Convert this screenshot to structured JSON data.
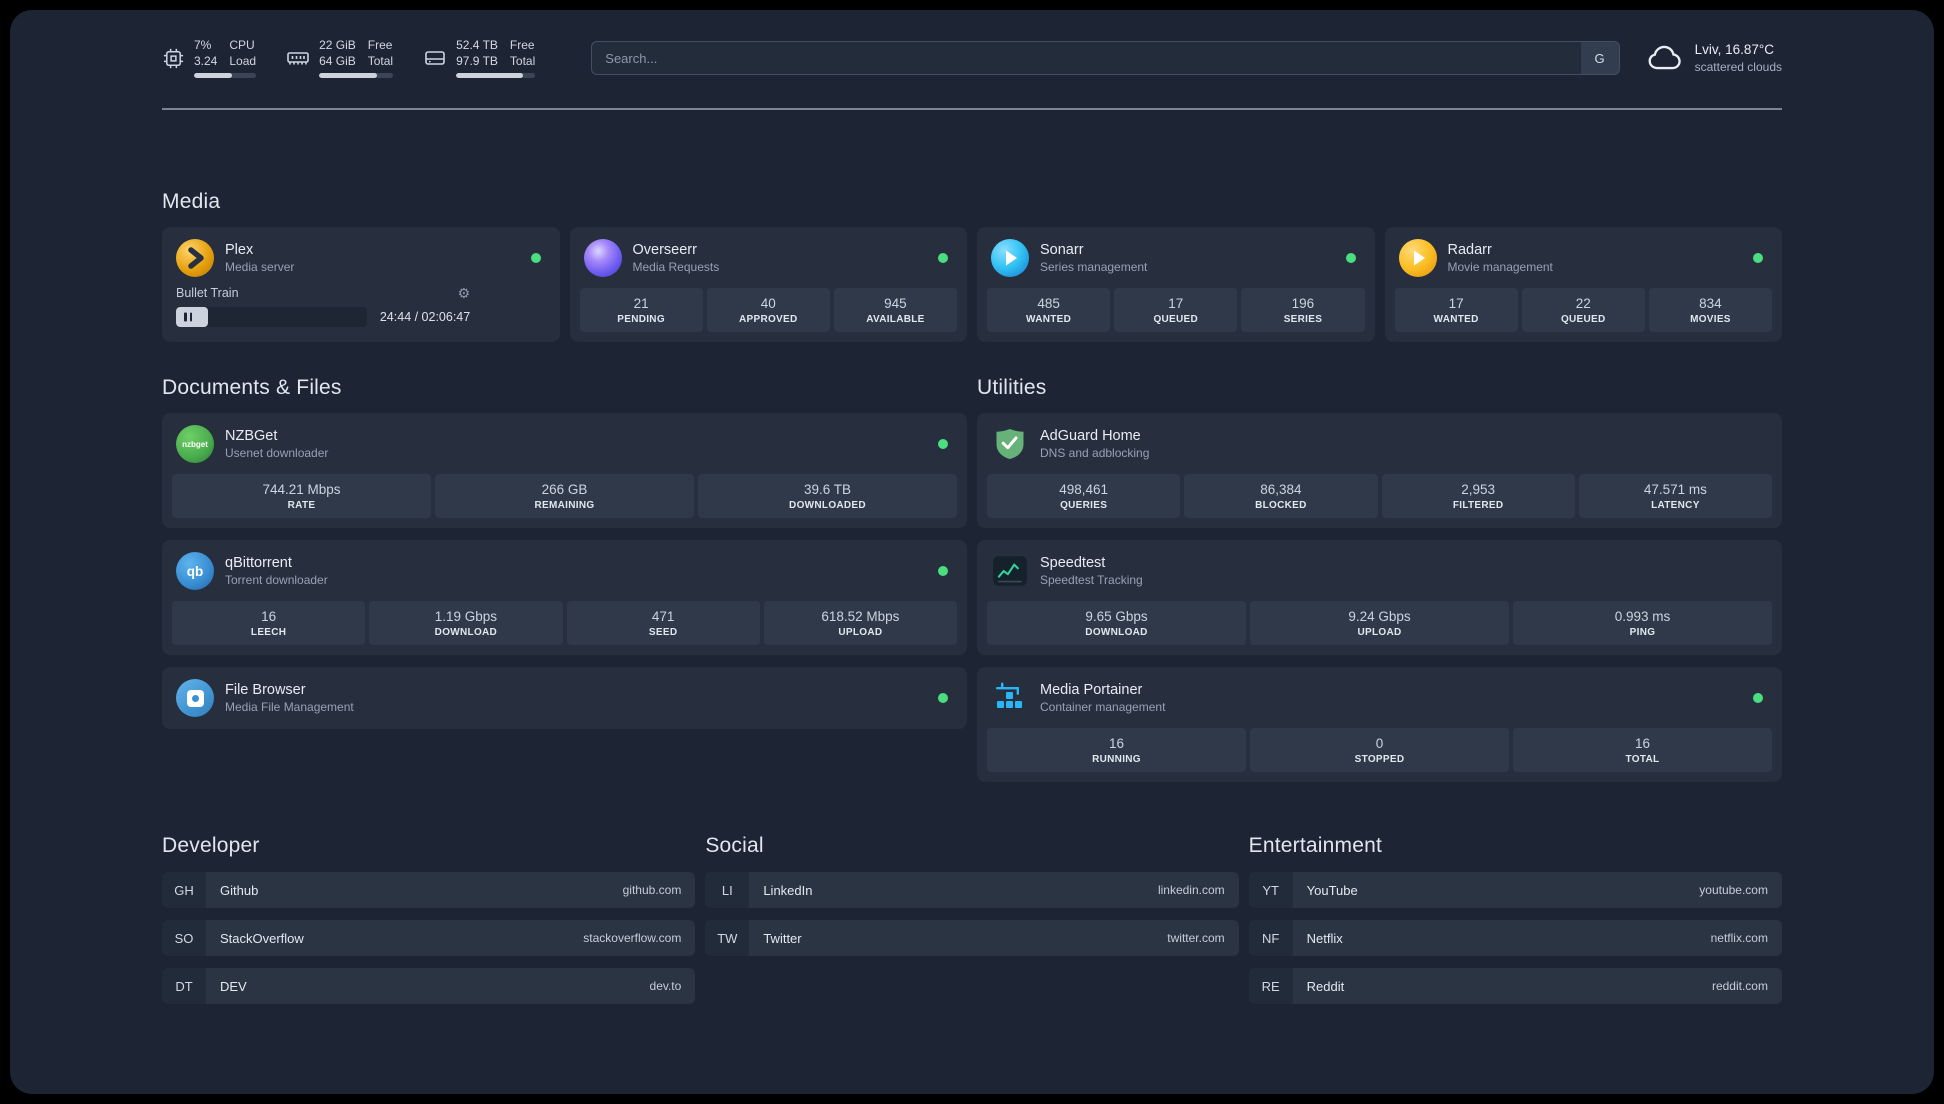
{
  "topbar": {
    "cpu": {
      "percent": "7%",
      "load": "3.24",
      "label_top": "CPU",
      "label_bottom": "Load"
    },
    "memory": {
      "free": "22 GiB",
      "total": "64 GiB",
      "label_top": "Free",
      "label_bottom": "Total"
    },
    "disk": {
      "free": "52.4 TB",
      "total": "97.9 TB",
      "label_top": "Free",
      "label_bottom": "Total"
    },
    "search": {
      "placeholder": "Search...",
      "provider_label": "G"
    },
    "weather": {
      "location": "Lviv, 16.87°C",
      "condition": "scattered clouds"
    }
  },
  "sections": {
    "media": "Media",
    "documents": "Documents & Files",
    "utilities": "Utilities",
    "developer": "Developer",
    "social": "Social",
    "entertainment": "Entertainment"
  },
  "icons": {
    "gear": "⚙"
  },
  "services": {
    "plex": {
      "name": "Plex",
      "desc": "Media server",
      "player": {
        "title": "Bullet Train",
        "time": "24:44 / 02:06:47"
      }
    },
    "overseerr": {
      "name": "Overseerr",
      "desc": "Media Requests",
      "stats": [
        {
          "value": "21",
          "label": "PENDING"
        },
        {
          "value": "40",
          "label": "APPROVED"
        },
        {
          "value": "945",
          "label": "AVAILABLE"
        }
      ]
    },
    "sonarr": {
      "name": "Sonarr",
      "desc": "Series management",
      "stats": [
        {
          "value": "485",
          "label": "WANTED"
        },
        {
          "value": "17",
          "label": "QUEUED"
        },
        {
          "value": "196",
          "label": "SERIES"
        }
      ]
    },
    "radarr": {
      "name": "Radarr",
      "desc": "Movie management",
      "stats": [
        {
          "value": "17",
          "label": "WANTED"
        },
        {
          "value": "22",
          "label": "QUEUED"
        },
        {
          "value": "834",
          "label": "MOVIES"
        }
      ]
    },
    "nzbget": {
      "name": "NZBGet",
      "desc": "Usenet downloader",
      "icon_label": "nzbget",
      "stats": [
        {
          "value": "744.21 Mbps",
          "label": "RATE"
        },
        {
          "value": "266 GB",
          "label": "REMAINING"
        },
        {
          "value": "39.6 TB",
          "label": "DOWNLOADED"
        }
      ]
    },
    "qbittorrent": {
      "name": "qBittorrent",
      "desc": "Torrent downloader",
      "icon_label": "qb",
      "stats": [
        {
          "value": "16",
          "label": "LEECH"
        },
        {
          "value": "1.19 Gbps",
          "label": "DOWNLOAD"
        },
        {
          "value": "471",
          "label": "SEED"
        },
        {
          "value": "618.52 Mbps",
          "label": "UPLOAD"
        }
      ]
    },
    "filebrowser": {
      "name": "File Browser",
      "desc": "Media File Management"
    },
    "adguard": {
      "name": "AdGuard Home",
      "desc": "DNS and adblocking",
      "stats": [
        {
          "value": "498,461",
          "label": "QUERIES"
        },
        {
          "value": "86,384",
          "label": "BLOCKED"
        },
        {
          "value": "2,953",
          "label": "FILTERED"
        },
        {
          "value": "47.571 ms",
          "label": "LATENCY"
        }
      ]
    },
    "speedtest": {
      "name": "Speedtest",
      "desc": "Speedtest Tracking",
      "stats": [
        {
          "value": "9.65 Gbps",
          "label": "DOWNLOAD"
        },
        {
          "value": "9.24 Gbps",
          "label": "UPLOAD"
        },
        {
          "value": "0.993 ms",
          "label": "PING"
        }
      ]
    },
    "portainer": {
      "name": "Media Portainer",
      "desc": "Container management",
      "stats": [
        {
          "value": "16",
          "label": "RUNNING"
        },
        {
          "value": "0",
          "label": "STOPPED"
        },
        {
          "value": "16",
          "label": "TOTAL"
        }
      ]
    }
  },
  "bookmarks": {
    "developer": [
      {
        "abbr": "GH",
        "name": "Github",
        "url": "github.com"
      },
      {
        "abbr": "SO",
        "name": "StackOverflow",
        "url": "stackoverflow.com"
      },
      {
        "abbr": "DT",
        "name": "DEV",
        "url": "dev.to"
      }
    ],
    "social": [
      {
        "abbr": "LI",
        "name": "LinkedIn",
        "url": "linkedin.com"
      },
      {
        "abbr": "TW",
        "name": "Twitter",
        "url": "twitter.com"
      }
    ],
    "entertainment": [
      {
        "abbr": "YT",
        "name": "YouTube",
        "url": "youtube.com"
      },
      {
        "abbr": "NF",
        "name": "Netflix",
        "url": "netflix.com"
      },
      {
        "abbr": "RE",
        "name": "Reddit",
        "url": "reddit.com"
      }
    ]
  },
  "colors": {
    "status_online": "#4ade80",
    "background": "#1d2433",
    "card": "#272f3e"
  }
}
